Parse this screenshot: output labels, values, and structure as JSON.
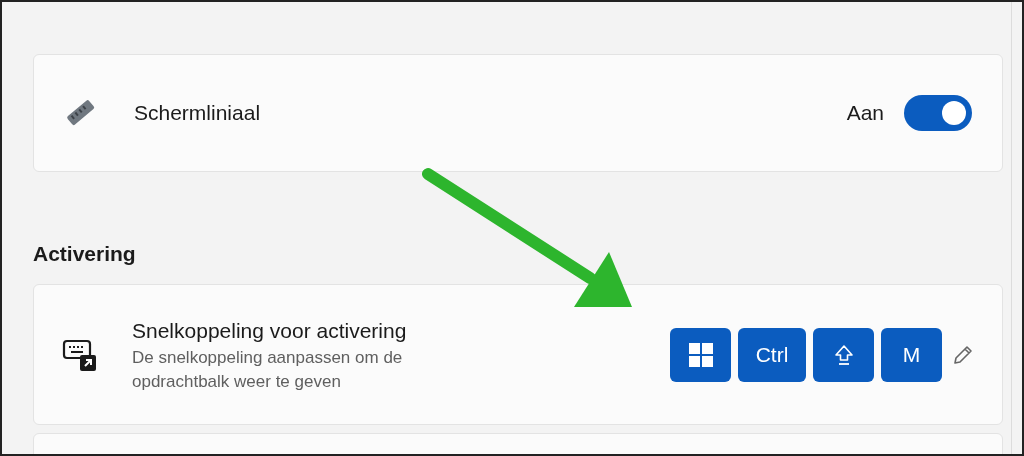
{
  "ruler_setting": {
    "label": "Schermliniaal",
    "state_label": "Aan",
    "on": true
  },
  "section_heading": "Activering",
  "shortcut_setting": {
    "title": "Snelkoppeling voor activering",
    "description": "De snelkoppeling aanpassen om de opdrachtbalk weer te geven",
    "keys": [
      {
        "kind": "windows"
      },
      {
        "kind": "text",
        "label": "Ctrl"
      },
      {
        "kind": "shift"
      },
      {
        "kind": "text",
        "label": "M"
      }
    ]
  }
}
